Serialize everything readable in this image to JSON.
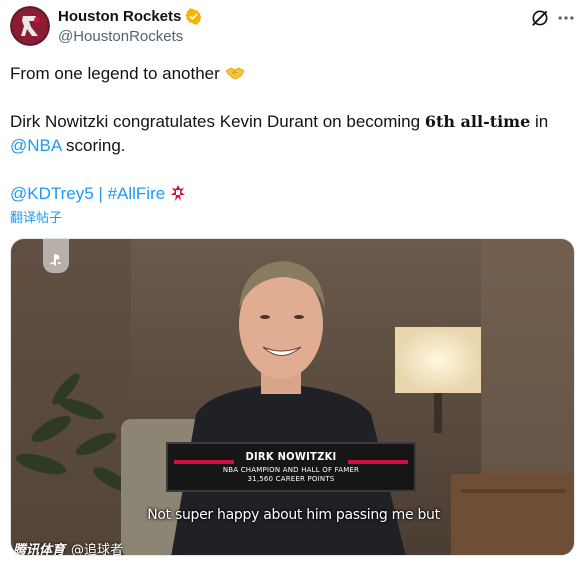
{
  "author": {
    "display_name": "Houston Rockets",
    "handle": "@HoustonRockets",
    "verified": true,
    "verified_color": "#f4b400"
  },
  "tweet": {
    "line1": "From one legend to another",
    "line1_emoji": "handshake-emoji",
    "line2_a": "Dirk Nowitzki congratulates Kevin Durant on becoming ",
    "line2_bold": "6th all-time",
    "line2_b": " in",
    "line2_link": "@NBA",
    "line2_c": " scoring.",
    "mention": "@KDTrey5",
    "separator": " | ",
    "hashtag": "#AllFire",
    "hashtag_icon": "rockets-icon",
    "link_color": "#1d9bf0"
  },
  "translate_label": "翻译帖子",
  "media": {
    "lower_third": {
      "name": "DIRK NOWITZKI",
      "line1": "NBA CHAMPION AND HALL OF FAMER",
      "line2": "31,560 CAREER POINTS",
      "accent": "#ce1141"
    },
    "subtitle": "Not super happy about him passing me but",
    "watermark": {
      "brand": "腾讯体育",
      "credit": "@追球者"
    }
  },
  "icons": {
    "grok": "grok-icon",
    "more": "more-icon"
  }
}
